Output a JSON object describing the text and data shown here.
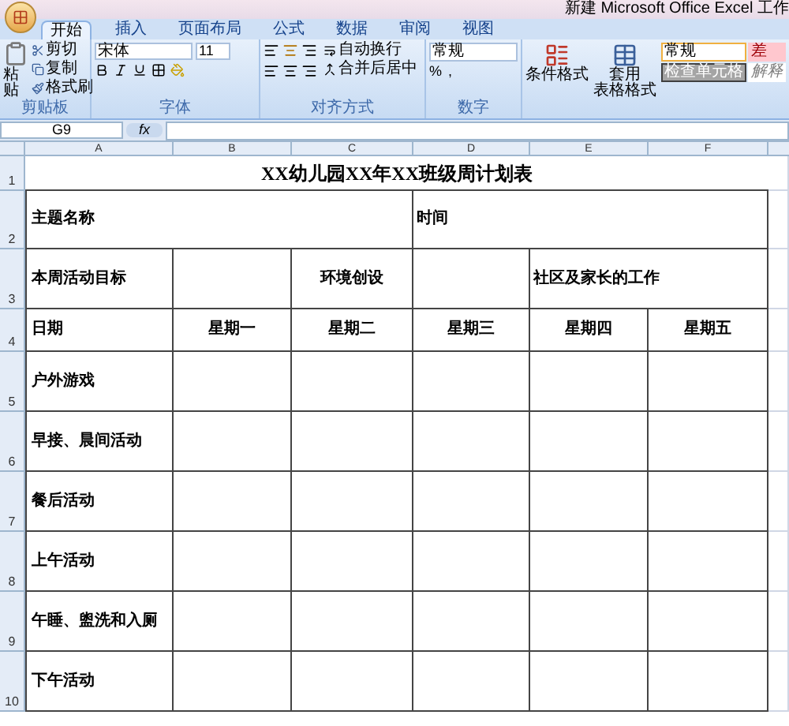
{
  "title_bar": {
    "title": "新建 Microsoft Office Excel 工作"
  },
  "ribbon": {
    "tabs": [
      {
        "label": "开始",
        "selected": true
      },
      {
        "label": "插入",
        "selected": false
      },
      {
        "label": "页面布局",
        "selected": false
      },
      {
        "label": "公式",
        "selected": false
      },
      {
        "label": "数据",
        "selected": false
      },
      {
        "label": "审阅",
        "selected": false
      },
      {
        "label": "视图",
        "selected": false
      }
    ],
    "clipboard": {
      "paste": "粘贴",
      "cut": "剪切",
      "copy": "复制",
      "format_painter": "格式刷",
      "group_label": "剪贴板"
    },
    "font": {
      "font_name": "宋体",
      "font_size": "11",
      "group_label": "字体"
    },
    "alignment": {
      "wrap_text": "自动换行",
      "merge_center": "合并后居中",
      "group_label": "对齐方式"
    },
    "number": {
      "format": "常规",
      "percent": "%",
      "comma": ",",
      "group_label": "数字"
    },
    "styles": {
      "conditional_format": "条件格式",
      "table_format_1": "套用",
      "table_format_2": "表格格式",
      "cell_styles": [
        "常规",
        "差",
        "检查单元格",
        "解释"
      ]
    }
  },
  "formula_bar": {
    "name_box": "G9",
    "fx": "fx"
  },
  "sheet": {
    "columns": [
      "A",
      "B",
      "C",
      "D",
      "E",
      "F"
    ],
    "title": {
      "row": "1",
      "text": "XX幼儿园XX年XX班级周计划表"
    },
    "subject_row": {
      "row": "2",
      "subject_label": "主题名称",
      "time_label": "时间"
    },
    "goals_row": {
      "row": "3",
      "goals_label": "本周活动目标",
      "environment_label": "环境创设",
      "community_label": "社区及家长的工作"
    },
    "date_row": {
      "row": "4",
      "date_label": "日期",
      "days": [
        "星期一",
        "星期二",
        "星期三",
        "星期四",
        "星期五"
      ]
    },
    "activity_rows": [
      {
        "row": "5",
        "label": "户外游戏"
      },
      {
        "row": "6",
        "label": "早接、晨间活动"
      },
      {
        "row": "7",
        "label": "餐后活动"
      },
      {
        "row": "8",
        "label": "上午活动"
      },
      {
        "row": "9",
        "label": "午睡、盥洗和入厕"
      },
      {
        "row": "10",
        "label": "下午活动"
      }
    ]
  }
}
